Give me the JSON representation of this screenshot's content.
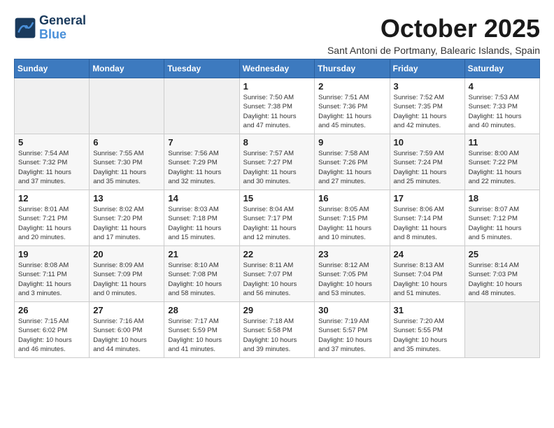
{
  "logo": {
    "line1": "General",
    "line2": "Blue"
  },
  "title": "October 2025",
  "subtitle": "Sant Antoni de Portmany, Balearic Islands, Spain",
  "days_of_week": [
    "Sunday",
    "Monday",
    "Tuesday",
    "Wednesday",
    "Thursday",
    "Friday",
    "Saturday"
  ],
  "weeks": [
    [
      {
        "day": "",
        "info": ""
      },
      {
        "day": "",
        "info": ""
      },
      {
        "day": "",
        "info": ""
      },
      {
        "day": "1",
        "info": "Sunrise: 7:50 AM\nSunset: 7:38 PM\nDaylight: 11 hours\nand 47 minutes."
      },
      {
        "day": "2",
        "info": "Sunrise: 7:51 AM\nSunset: 7:36 PM\nDaylight: 11 hours\nand 45 minutes."
      },
      {
        "day": "3",
        "info": "Sunrise: 7:52 AM\nSunset: 7:35 PM\nDaylight: 11 hours\nand 42 minutes."
      },
      {
        "day": "4",
        "info": "Sunrise: 7:53 AM\nSunset: 7:33 PM\nDaylight: 11 hours\nand 40 minutes."
      }
    ],
    [
      {
        "day": "5",
        "info": "Sunrise: 7:54 AM\nSunset: 7:32 PM\nDaylight: 11 hours\nand 37 minutes."
      },
      {
        "day": "6",
        "info": "Sunrise: 7:55 AM\nSunset: 7:30 PM\nDaylight: 11 hours\nand 35 minutes."
      },
      {
        "day": "7",
        "info": "Sunrise: 7:56 AM\nSunset: 7:29 PM\nDaylight: 11 hours\nand 32 minutes."
      },
      {
        "day": "8",
        "info": "Sunrise: 7:57 AM\nSunset: 7:27 PM\nDaylight: 11 hours\nand 30 minutes."
      },
      {
        "day": "9",
        "info": "Sunrise: 7:58 AM\nSunset: 7:26 PM\nDaylight: 11 hours\nand 27 minutes."
      },
      {
        "day": "10",
        "info": "Sunrise: 7:59 AM\nSunset: 7:24 PM\nDaylight: 11 hours\nand 25 minutes."
      },
      {
        "day": "11",
        "info": "Sunrise: 8:00 AM\nSunset: 7:22 PM\nDaylight: 11 hours\nand 22 minutes."
      }
    ],
    [
      {
        "day": "12",
        "info": "Sunrise: 8:01 AM\nSunset: 7:21 PM\nDaylight: 11 hours\nand 20 minutes."
      },
      {
        "day": "13",
        "info": "Sunrise: 8:02 AM\nSunset: 7:20 PM\nDaylight: 11 hours\nand 17 minutes."
      },
      {
        "day": "14",
        "info": "Sunrise: 8:03 AM\nSunset: 7:18 PM\nDaylight: 11 hours\nand 15 minutes."
      },
      {
        "day": "15",
        "info": "Sunrise: 8:04 AM\nSunset: 7:17 PM\nDaylight: 11 hours\nand 12 minutes."
      },
      {
        "day": "16",
        "info": "Sunrise: 8:05 AM\nSunset: 7:15 PM\nDaylight: 11 hours\nand 10 minutes."
      },
      {
        "day": "17",
        "info": "Sunrise: 8:06 AM\nSunset: 7:14 PM\nDaylight: 11 hours\nand 8 minutes."
      },
      {
        "day": "18",
        "info": "Sunrise: 8:07 AM\nSunset: 7:12 PM\nDaylight: 11 hours\nand 5 minutes."
      }
    ],
    [
      {
        "day": "19",
        "info": "Sunrise: 8:08 AM\nSunset: 7:11 PM\nDaylight: 11 hours\nand 3 minutes."
      },
      {
        "day": "20",
        "info": "Sunrise: 8:09 AM\nSunset: 7:09 PM\nDaylight: 11 hours\nand 0 minutes."
      },
      {
        "day": "21",
        "info": "Sunrise: 8:10 AM\nSunset: 7:08 PM\nDaylight: 10 hours\nand 58 minutes."
      },
      {
        "day": "22",
        "info": "Sunrise: 8:11 AM\nSunset: 7:07 PM\nDaylight: 10 hours\nand 56 minutes."
      },
      {
        "day": "23",
        "info": "Sunrise: 8:12 AM\nSunset: 7:05 PM\nDaylight: 10 hours\nand 53 minutes."
      },
      {
        "day": "24",
        "info": "Sunrise: 8:13 AM\nSunset: 7:04 PM\nDaylight: 10 hours\nand 51 minutes."
      },
      {
        "day": "25",
        "info": "Sunrise: 8:14 AM\nSunset: 7:03 PM\nDaylight: 10 hours\nand 48 minutes."
      }
    ],
    [
      {
        "day": "26",
        "info": "Sunrise: 7:15 AM\nSunset: 6:02 PM\nDaylight: 10 hours\nand 46 minutes."
      },
      {
        "day": "27",
        "info": "Sunrise: 7:16 AM\nSunset: 6:00 PM\nDaylight: 10 hours\nand 44 minutes."
      },
      {
        "day": "28",
        "info": "Sunrise: 7:17 AM\nSunset: 5:59 PM\nDaylight: 10 hours\nand 41 minutes."
      },
      {
        "day": "29",
        "info": "Sunrise: 7:18 AM\nSunset: 5:58 PM\nDaylight: 10 hours\nand 39 minutes."
      },
      {
        "day": "30",
        "info": "Sunrise: 7:19 AM\nSunset: 5:57 PM\nDaylight: 10 hours\nand 37 minutes."
      },
      {
        "day": "31",
        "info": "Sunrise: 7:20 AM\nSunset: 5:55 PM\nDaylight: 10 hours\nand 35 minutes."
      },
      {
        "day": "",
        "info": ""
      }
    ]
  ]
}
